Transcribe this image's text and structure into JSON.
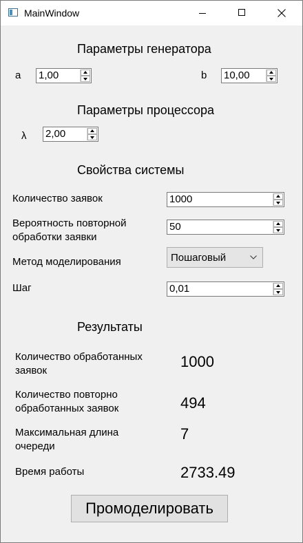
{
  "window": {
    "title": "MainWindow"
  },
  "generator": {
    "heading": "Параметры генератора",
    "a_label": "a",
    "a_value": "1,00",
    "b_label": "b",
    "b_value": "10,00"
  },
  "processor": {
    "heading": "Параметры процессора",
    "lambda_label": "λ",
    "lambda_value": "2,00"
  },
  "system": {
    "heading": "Свойства системы",
    "requests_label": "Количество заявок",
    "requests_value": "1000",
    "prob_label_line1": "Вероятность повторной",
    "prob_label_line2": "обработки заявки",
    "prob_value": "50",
    "method_label": "Метод моделирования",
    "method_value": "Пошаговый",
    "step_label": "Шаг",
    "step_value": "0,01"
  },
  "results": {
    "heading": "Результаты",
    "processed_label_line1": "Количество обработанных",
    "processed_label_line2": "заявок",
    "processed_value": "1000",
    "reprocessed_label_line1": "Количество повторно",
    "reprocessed_label_line2": "обработанных заявок",
    "reprocessed_value": "494",
    "queue_label_line1": "Максимальная длина",
    "queue_label_line2": "очереди",
    "queue_value": "7",
    "time_label": "Время работы",
    "time_value": "2733.49"
  },
  "actions": {
    "run_label": "Промоделировать"
  },
  "icons": {
    "app": "app-window-icon",
    "minimize": "minimize-icon",
    "maximize": "maximize-icon",
    "close": "close-icon",
    "spin_up": "chevron-up-icon",
    "spin_down": "chevron-down-icon",
    "combo": "chevron-down-icon"
  }
}
